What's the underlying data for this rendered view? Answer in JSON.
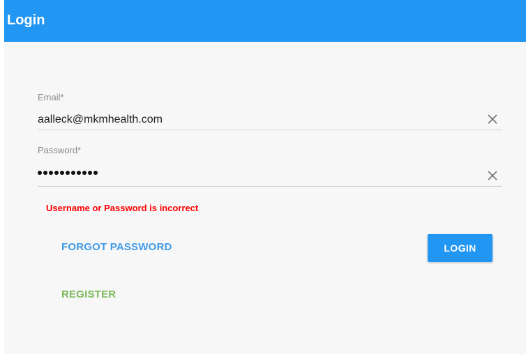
{
  "dialog": {
    "title": "Login"
  },
  "form": {
    "email": {
      "label": "Email*",
      "value": "aalleck@mkmhealth.com"
    },
    "password": {
      "label": "Password*",
      "masked_length": 11
    },
    "error_message": "Username or Password is incorrect"
  },
  "actions": {
    "forgot_password": "FORGOT PASSWORD",
    "login": "LOGIN",
    "register": "REGISTER"
  },
  "colors": {
    "primary": "#2196f3",
    "error": "#ff0000",
    "link": "#3f9be8",
    "register": "#7cb95b"
  },
  "icons": {
    "clear": "close-icon"
  }
}
